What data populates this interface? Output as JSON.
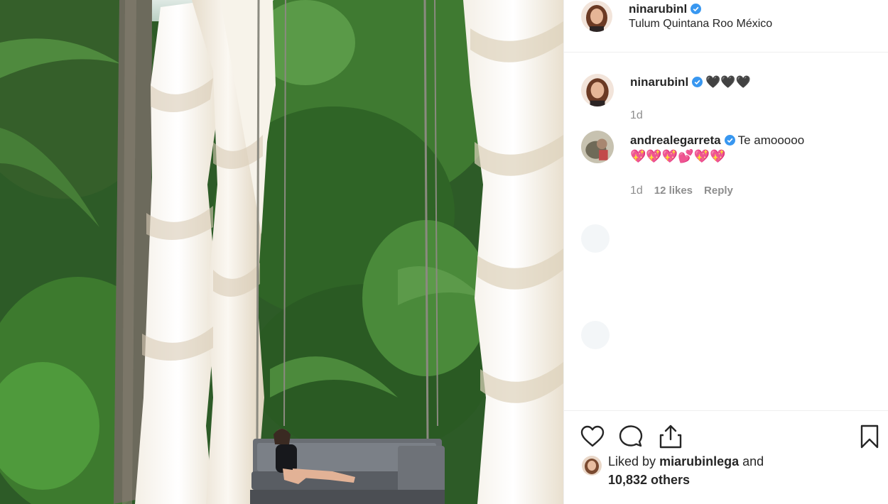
{
  "post": {
    "username": "ninarubinl",
    "location": "Tulum Quintana Roo México"
  },
  "comments": [
    {
      "username": "ninarubinl",
      "text": "🖤🖤🖤",
      "time": "1d"
    },
    {
      "username": "andrealegarreta",
      "text": "Te amooooo",
      "text2": "💖💖💖💕💖💖",
      "time": "1d",
      "likes": "12 likes",
      "reply": "Reply"
    }
  ],
  "likes": {
    "prefix": "Liked by",
    "user": "miarubinlega",
    "connector": "and",
    "others": "10,832 others"
  },
  "icons": {
    "like": "heart-icon",
    "comment": "comment-bubble-icon",
    "share": "share-icon",
    "save": "bookmark-icon",
    "verified": "verified-badge-icon"
  },
  "colors": {
    "verified": "#3897f0",
    "text": "#262626",
    "muted": "#8e8e8e",
    "divider": "#efefef"
  }
}
